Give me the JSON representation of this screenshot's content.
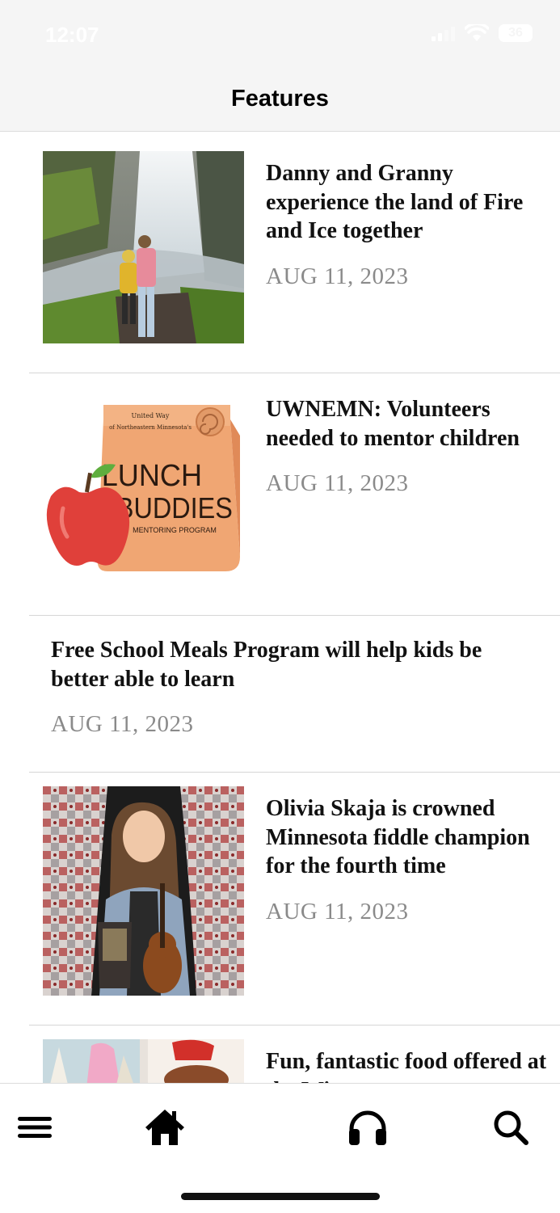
{
  "status_bar": {
    "time": "12:07",
    "battery": "36"
  },
  "header": {
    "title": "Features"
  },
  "articles": [
    {
      "headline": "Danny and Granny experience the land of Fire and Ice together",
      "date": "AUG 11, 2023",
      "image": "waterfall-photo"
    },
    {
      "headline": "UWNEMN: Volunteers needed to mentor children",
      "date": "AUG 11, 2023",
      "image": "lunch-buddies-graphic",
      "image_text": {
        "org_line1": "United Way",
        "org_line2": "of Northeastern Minnesota's",
        "title_line1": "LUNCH",
        "title_line2": "BUDDIES",
        "subtitle": "MENTORING PROGRAM"
      }
    },
    {
      "headline": "Free School Meals Program will help kids be better able to learn",
      "date": "AUG 11, 2023"
    },
    {
      "headline": "Olivia Skaja is crowned Minnesota fiddle champion for the fourth time",
      "date": "AUG 11, 2023",
      "image": "fiddle-champion-photo"
    },
    {
      "headline": "Fun, fantastic food offered at the Wi...",
      "date": "",
      "image": "food-photo"
    }
  ],
  "tab_bar": {
    "items": [
      "menu-icon",
      "home-icon",
      "headphones-icon",
      "search-icon"
    ]
  }
}
